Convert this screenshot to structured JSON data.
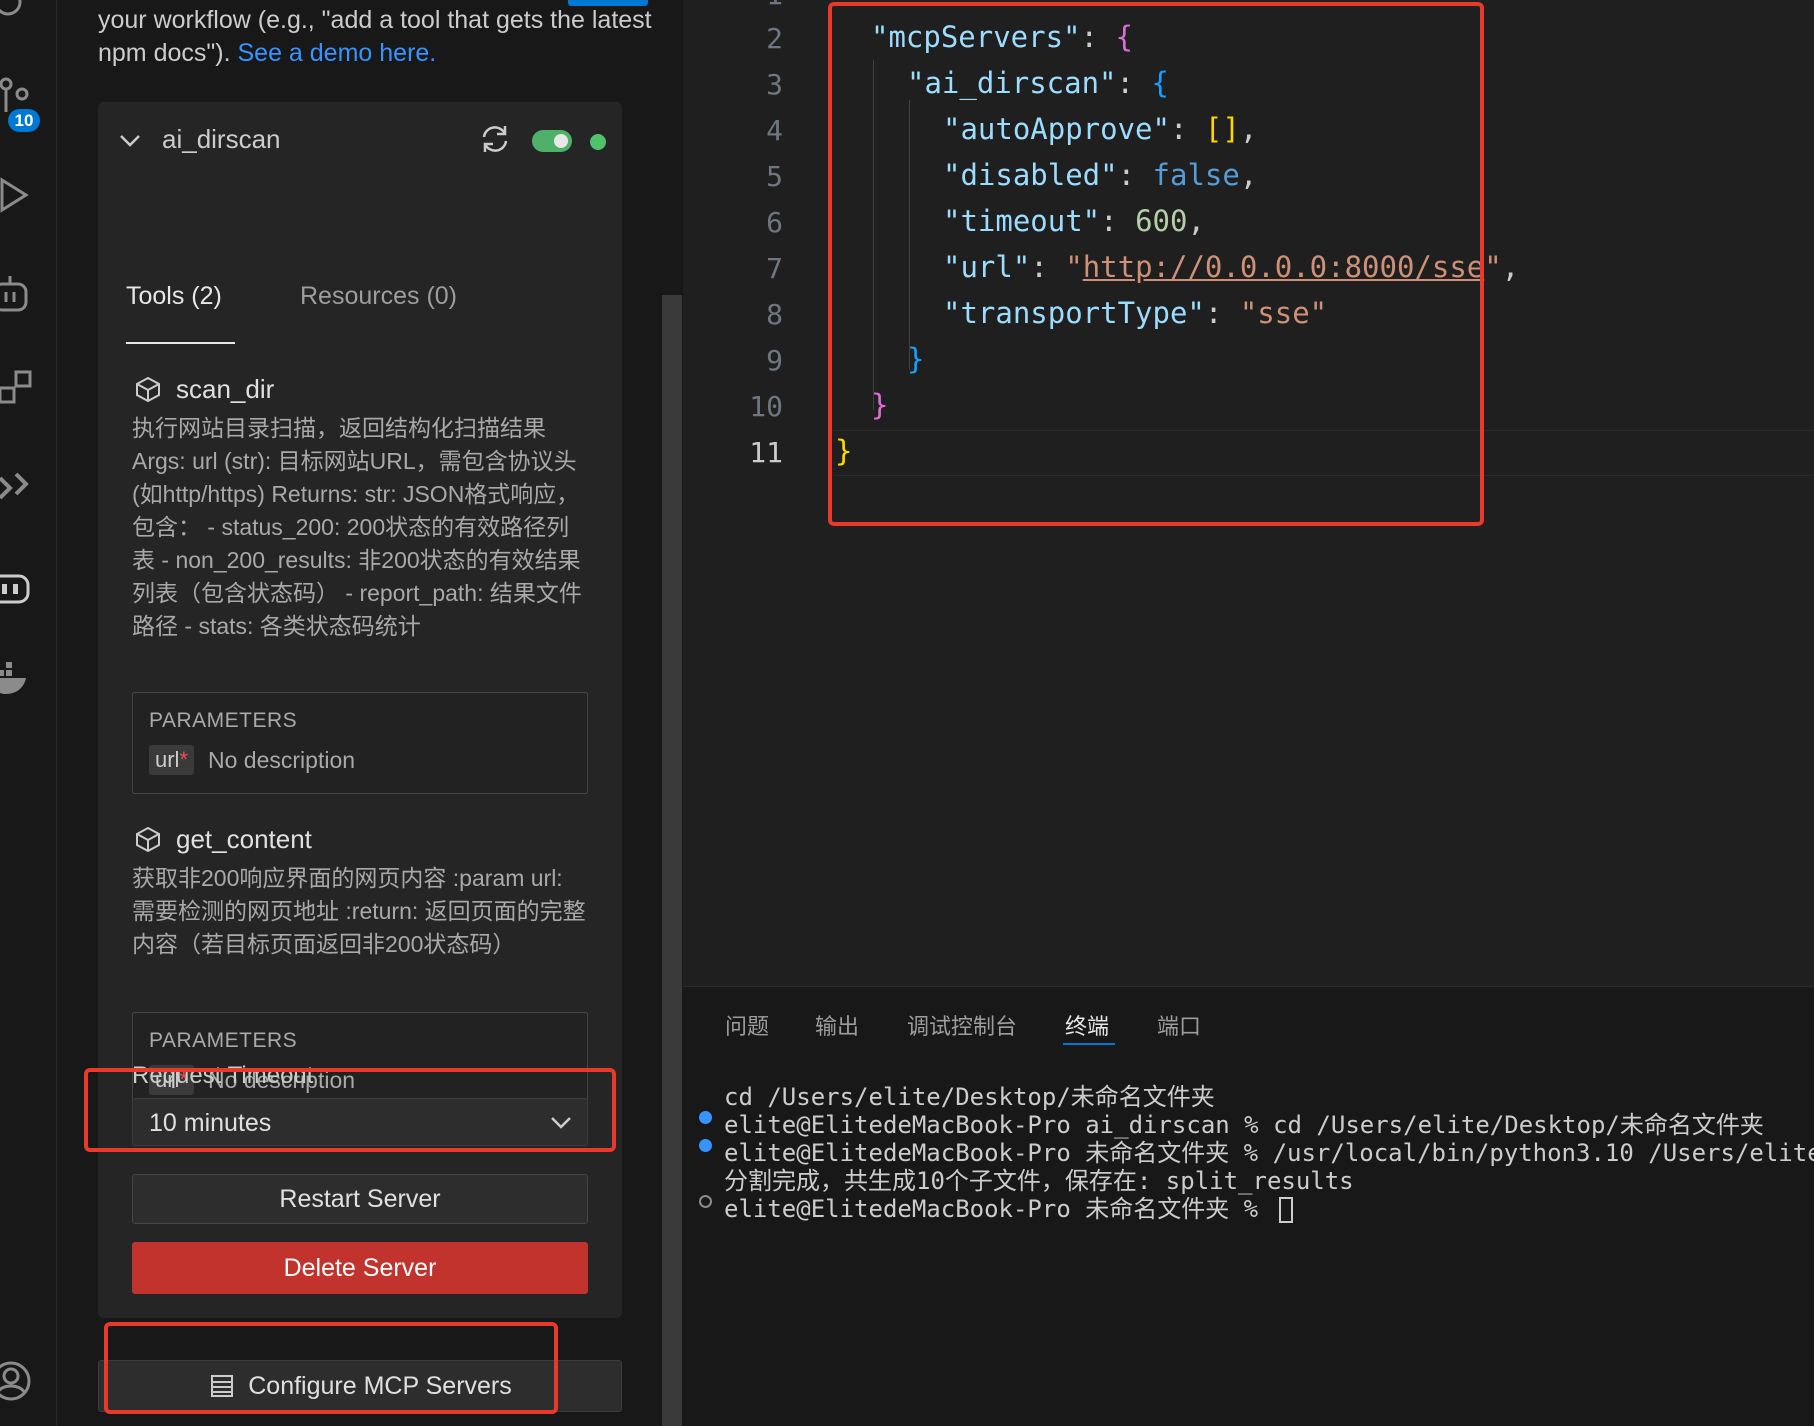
{
  "activity_bar": {
    "source_control_badge": "10"
  },
  "sidebar": {
    "intro_text": "your workflow (e.g., \"add a tool that gets the latest npm docs\").",
    "intro_link": "See a demo here.",
    "server": {
      "name": "ai_dirscan",
      "enabled": true,
      "status_color": "#4fc26a",
      "tabs": [
        {
          "label": "Tools (2)",
          "active": true
        },
        {
          "label": "Resources (0)",
          "active": false
        }
      ],
      "tools": [
        {
          "name": "scan_dir",
          "description": "执行网站目录扫描，返回结构化扫描结果 Args: url (str): 目标网站URL，需包含协议头(如http/https) Returns: str: JSON格式响应，包含：  - status_200: 200状态的有效路径列表 - non_200_results: 非200状态的有效结果列表（包含状态码） - report_path: 结果文件路径 - stats: 各类状态码统计",
          "params_label": "PARAMETERS",
          "param_name": "url",
          "param_required": "*",
          "param_desc": "No description"
        },
        {
          "name": "get_content",
          "description": "获取非200响应界面的网页内容 :param url: 需要检测的网页地址 :return: 返回页面的完整内容（若目标页面返回非200状态码）",
          "params_label": "PARAMETERS",
          "param_name": "url",
          "param_required": "*",
          "param_desc": "No description"
        }
      ],
      "request_timeout_label": "Request Timeout",
      "request_timeout_value": "10 minutes",
      "restart_label": "Restart Server",
      "delete_label": "Delete Server"
    },
    "configure_label": "Configure MCP Servers"
  },
  "editor": {
    "line_numbers": [
      "2",
      "3",
      "4",
      "5",
      "6",
      "7",
      "8",
      "9",
      "10",
      "11"
    ],
    "current_line": "11",
    "code": {
      "k_mcpServers": "\"mcpServers\"",
      "k_ai_dirscan": "\"ai_dirscan\"",
      "k_autoApprove": "\"autoApprove\"",
      "k_disabled": "\"disabled\"",
      "v_disabled": "false",
      "k_timeout": "\"timeout\"",
      "v_timeout": "600",
      "k_url": "\"url\"",
      "v_url": "http://0.0.0.0:8000/sse",
      "k_transportType": "\"transportType\"",
      "v_transportType": "\"sse\""
    }
  },
  "panel": {
    "tabs": [
      {
        "label": "问题",
        "active": false
      },
      {
        "label": "输出",
        "active": false
      },
      {
        "label": "调试控制台",
        "active": false
      },
      {
        "label": "终端",
        "active": true
      },
      {
        "label": "端口",
        "active": false
      }
    ],
    "terminal_lines": [
      "cd /Users/elite/Desktop/未命名文件夹",
      "elite@ElitedeMacBook-Pro ai_dirscan % cd /Users/elite/Desktop/未命名文件夹",
      "elite@ElitedeMacBook-Pro 未命名文件夹 % /usr/local/bin/python3.10 /Users/elite",
      "分割完成，共生成10个子文件，保存在: split_results",
      "elite@ElitedeMacBook-Pro 未命名文件夹 % "
    ]
  },
  "colors": {
    "highlight": "#e8392b",
    "delete_button": "#c3332e",
    "accent": "#0078d4"
  }
}
